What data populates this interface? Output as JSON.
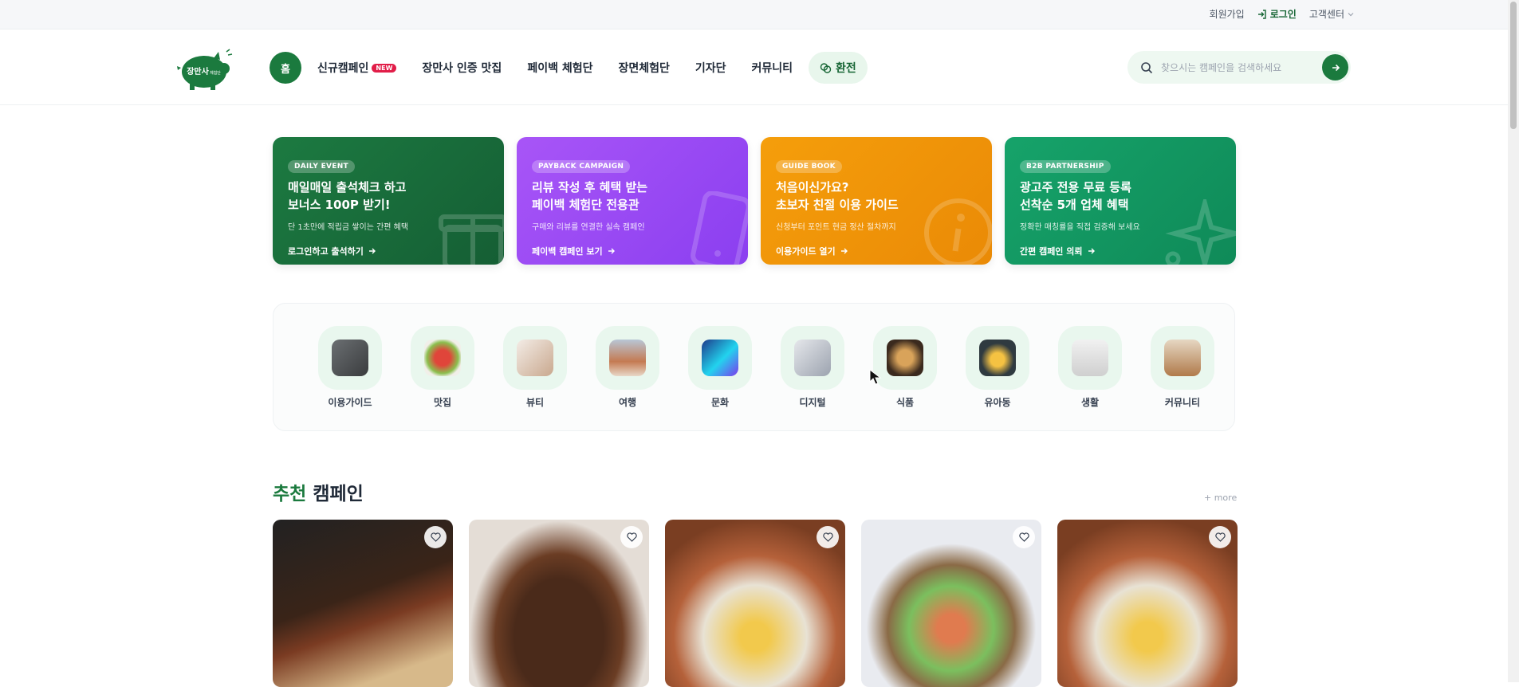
{
  "topbar": {
    "signup": "회원가입",
    "login": "로그인",
    "customer_center": "고객센터"
  },
  "logo": {
    "text": "장만사",
    "subtext": "체험단"
  },
  "nav": {
    "home": "홈",
    "items": [
      {
        "label": "신규캠페인",
        "badge": "NEW"
      },
      {
        "label": "장만사 인증 맛집"
      },
      {
        "label": "페이백 체험단"
      },
      {
        "label": "장면체험단"
      },
      {
        "label": "기자단"
      },
      {
        "label": "커뮤니티"
      }
    ],
    "exchange": "환전"
  },
  "search": {
    "placeholder": "찾으시는 캠페인을 검색하세요"
  },
  "banners": [
    {
      "tag": "DAILY EVENT",
      "title1": "매일매일 출석체크 하고",
      "title2": "보너스 100P 받기!",
      "desc": "단 1초만에 적립금 쌓이는 간편 혜택",
      "cta": "로그인하고 출석하기",
      "icon": "gift-icon"
    },
    {
      "tag": "PAYBACK CAMPAIGN",
      "title1": "리뷰 작성 후 혜택 받는",
      "title2": "페이백 체험단 전용관",
      "desc": "구매와 리뷰를 연결한 실속 캠페인",
      "cta": "페이백 캠페인 보기",
      "icon": "phone-icon"
    },
    {
      "tag": "GUIDE BOOK",
      "title1": "처음이신가요?",
      "title2": "초보자 친절 이용 가이드",
      "desc": "신청부터 포인트 현금 정산 절차까지",
      "cta": "이용가이드 열기",
      "icon": "info-icon"
    },
    {
      "tag": "B2B PARTNERSHIP",
      "title1": "광고주 전용 무료 등록",
      "title2": "선착순 5개 업체 혜택",
      "desc": "정확한 매칭률을 직접 검증해 보세요",
      "cta": "간편 캠페인 의뢰",
      "icon": "sparkle-icon"
    }
  ],
  "categories": [
    {
      "label": "이용가이드"
    },
    {
      "label": "맛집"
    },
    {
      "label": "뷰티"
    },
    {
      "label": "여행"
    },
    {
      "label": "문화"
    },
    {
      "label": "디지털"
    },
    {
      "label": "식품"
    },
    {
      "label": "유아동"
    },
    {
      "label": "생활"
    },
    {
      "label": "커뮤니티"
    }
  ],
  "section": {
    "title_highlight": "추천",
    "title_rest": " 캠페인",
    "more": "+ more"
  },
  "colors": {
    "brand": "#1b7a3e",
    "badge_new": "#e11d48"
  }
}
